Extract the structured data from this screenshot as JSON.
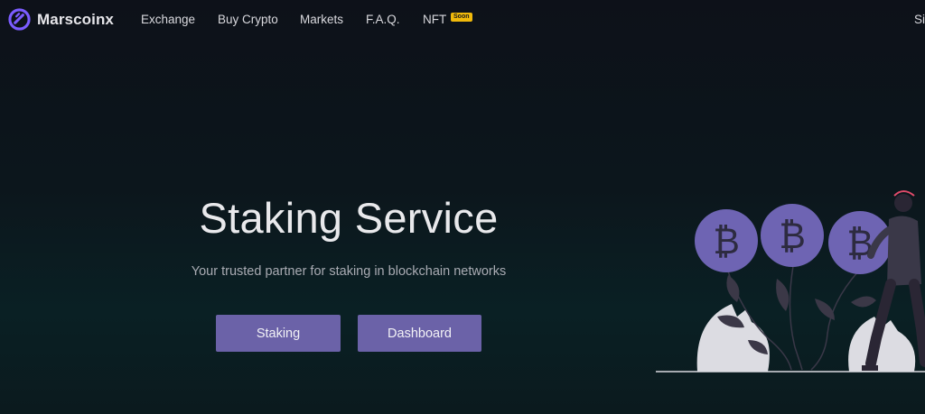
{
  "brand": {
    "name": "Marscoinx",
    "accent": "#7b5cff"
  },
  "nav": {
    "items": [
      {
        "label": "Exchange"
      },
      {
        "label": "Buy Crypto"
      },
      {
        "label": "Markets"
      },
      {
        "label": "F.A.Q."
      },
      {
        "label": "NFT"
      }
    ],
    "nft_badge": "Soon",
    "signin_label": "Si"
  },
  "hero": {
    "title": "Staking Service",
    "subtitle": "Your trusted partner for staking in blockchain networks",
    "buttons": {
      "staking": "Staking",
      "dashboard": "Dashboard"
    },
    "button_color": "#6b62a8"
  },
  "illustration": {
    "coin_symbol": "₿",
    "coin_color": "#6e64b3"
  }
}
